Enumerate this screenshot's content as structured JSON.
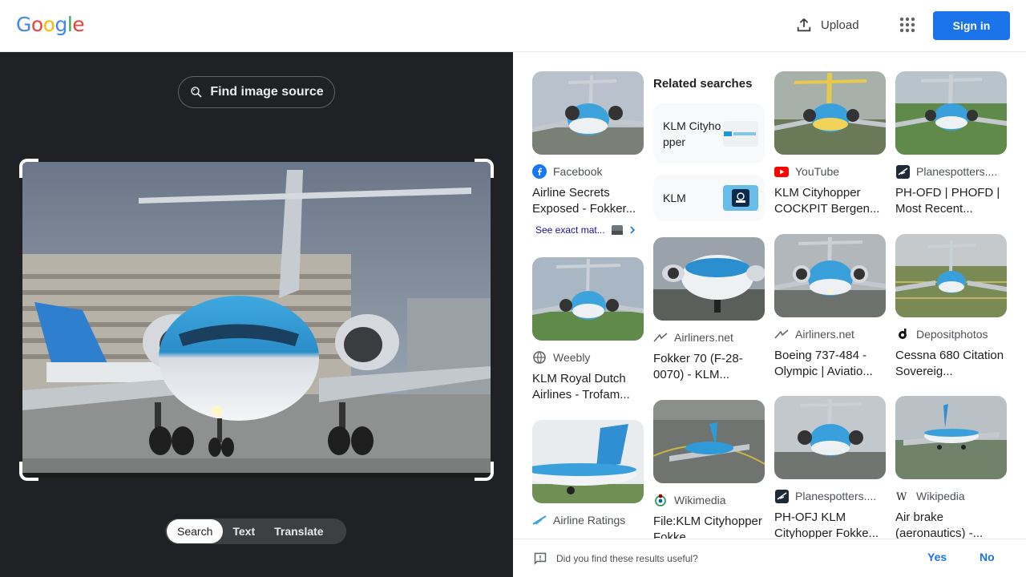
{
  "header": {
    "logo_letters": [
      "G",
      "o",
      "o",
      "g",
      "l",
      "e"
    ],
    "logo_colors": [
      "#4285f4",
      "#ea4335",
      "#fbbc05",
      "#4285f4",
      "#34a853",
      "#ea4335"
    ],
    "upload_label": "Upload",
    "signin_label": "Sign in"
  },
  "lens": {
    "find_source_label": "Find image source",
    "modes": [
      "Search",
      "Text",
      "Translate"
    ],
    "active_mode": "Search"
  },
  "related": {
    "heading": "Related searches",
    "items": [
      {
        "label": "KLM Cityhopper",
        "image": "klm-cityhopper-logo"
      },
      {
        "label": "KLM",
        "image": "klm-logo"
      }
    ]
  },
  "see_exact_matches": "See exact mat...",
  "results": [
    {
      "source": "Facebook",
      "icon": "facebook-icon",
      "title": "Airline Secrets Exposed - Fokker..."
    },
    {
      "source": "YouTube",
      "icon": "youtube-icon",
      "title": "KLM Cityhopper COCKPIT Bergen..."
    },
    {
      "source": "Planespotters....",
      "icon": "planespotters-icon",
      "title": "PH-OFD | PHOFD | Most Recent..."
    },
    {
      "source": "Weebly",
      "icon": "globe-icon",
      "title": "KLM Royal Dutch Airlines - Trofam..."
    },
    {
      "source": "Airliners.net",
      "icon": "airliners-icon",
      "title": "Fokker 70 (F-28-0070) - KLM..."
    },
    {
      "source": "Airliners.net",
      "icon": "airliners-icon",
      "title": "Boeing 737-484 - Olympic | Aviatio..."
    },
    {
      "source": "Depositphotos",
      "icon": "depositphotos-icon",
      "title": "Cessna 680 Citation Sovereig..."
    },
    {
      "source": "Airline Ratings",
      "icon": "airlineratings-icon",
      "title": ""
    },
    {
      "source": "Wikimedia",
      "icon": "wikimedia-icon",
      "title": "File:KLM Cityhopper Fokke..."
    },
    {
      "source": "Planespotters....",
      "icon": "planespotters-icon",
      "title": "PH-OFJ KLM Cityhopper Fokke..."
    },
    {
      "source": "Wikipedia",
      "icon": "wikipedia-icon",
      "title": "Air brake (aeronautics) -..."
    }
  ],
  "feedback": {
    "question": "Did you find these results useful?",
    "yes": "Yes",
    "no": "No"
  }
}
